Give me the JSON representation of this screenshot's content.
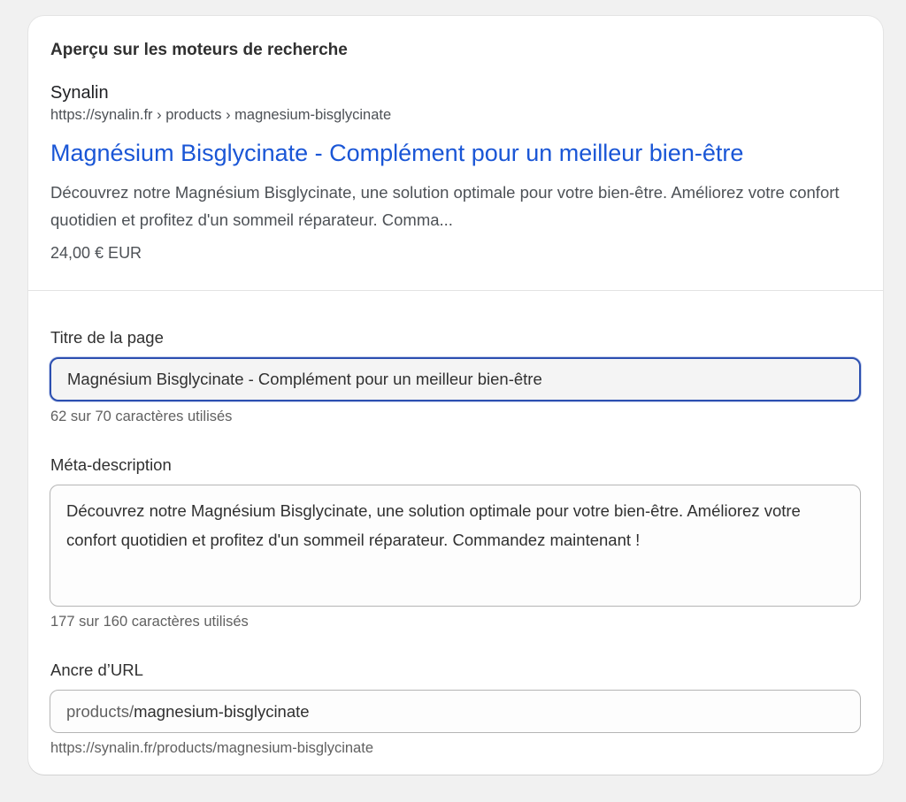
{
  "section": {
    "heading": "Aperçu sur les moteurs de recherche"
  },
  "preview": {
    "site_name": "Synalin",
    "breadcrumb_url": "https://synalin.fr › products › magnesium-bisglycinate",
    "title": "Magnésium Bisglycinate - Complément pour un meilleur bien-être",
    "description": "Découvrez notre Magnésium Bisglycinate, une solution optimale pour votre bien-être. Améliorez votre confort quotidien et profitez d'un sommeil réparateur. Comma...",
    "price": "24,00 € EUR",
    "colors": {
      "title_link": "#1a56d6",
      "muted_text": "#4d5156"
    }
  },
  "form": {
    "page_title": {
      "label": "Titre de la page",
      "value": "Magnésium Bisglycinate - Complément pour un meilleur bien-être",
      "help": "62 sur 70 caractères utilisés",
      "focused": true
    },
    "meta_description": {
      "label": "Méta-description",
      "value": "Découvrez notre Magnésium Bisglycinate, une solution optimale pour votre bien-être. Améliorez votre confort quotidien et profitez d'un sommeil réparateur. Commandez maintenant !",
      "help": "177 sur 160 caractères utilisés"
    },
    "url_handle": {
      "label": "Ancre d’URL",
      "prefix": "products/",
      "value": "magnesium-bisglycinate",
      "help": "https://synalin.fr/products/magnesium-bisglycinate"
    },
    "colors": {
      "focus_ring": "#2c4fb0"
    }
  }
}
